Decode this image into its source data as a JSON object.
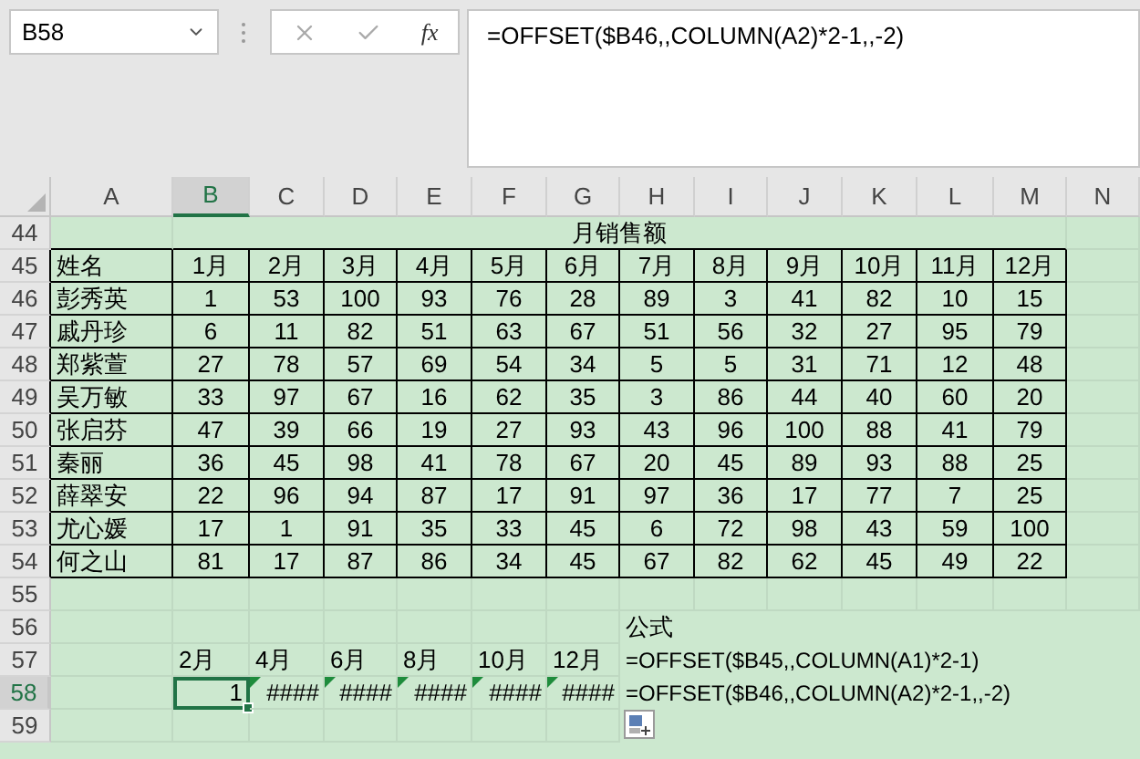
{
  "name_box": {
    "value": "B58"
  },
  "formula_bar": {
    "function_label": "fx",
    "formula": "=OFFSET($B46,,COLUMN(A2)*2-1,,-2)"
  },
  "columns": [
    {
      "label": "A",
      "selected": false
    },
    {
      "label": "B",
      "selected": true
    },
    {
      "label": "C",
      "selected": false
    },
    {
      "label": "D",
      "selected": false
    },
    {
      "label": "E",
      "selected": false
    },
    {
      "label": "F",
      "selected": false
    },
    {
      "label": "G",
      "selected": false
    },
    {
      "label": "H",
      "selected": false
    },
    {
      "label": "I",
      "selected": false
    },
    {
      "label": "J",
      "selected": false
    },
    {
      "label": "K",
      "selected": false
    },
    {
      "label": "L",
      "selected": false
    },
    {
      "label": "M",
      "selected": false
    },
    {
      "label": "N",
      "selected": false
    }
  ],
  "rows": [
    {
      "number": "44",
      "selected": false
    },
    {
      "number": "45",
      "selected": false
    },
    {
      "number": "46",
      "selected": false
    },
    {
      "number": "47",
      "selected": false
    },
    {
      "number": "48",
      "selected": false
    },
    {
      "number": "49",
      "selected": false
    },
    {
      "number": "50",
      "selected": false
    },
    {
      "number": "51",
      "selected": false
    },
    {
      "number": "52",
      "selected": false
    },
    {
      "number": "53",
      "selected": false
    },
    {
      "number": "54",
      "selected": false
    },
    {
      "number": "55",
      "selected": false
    },
    {
      "number": "56",
      "selected": false
    },
    {
      "number": "57",
      "selected": false
    },
    {
      "number": "58",
      "selected": true
    },
    {
      "number": "59",
      "selected": false
    }
  ],
  "title": "月销售额",
  "table": {
    "rows": [
      [
        "姓名",
        "1月",
        "2月",
        "3月",
        "4月",
        "5月",
        "6月",
        "7月",
        "8月",
        "9月",
        "10月",
        "11月",
        "12月"
      ],
      [
        "彭秀英",
        "1",
        "53",
        "100",
        "93",
        "76",
        "28",
        "89",
        "3",
        "41",
        "82",
        "10",
        "15"
      ],
      [
        "戚丹珍",
        "6",
        "11",
        "82",
        "51",
        "63",
        "67",
        "51",
        "56",
        "32",
        "27",
        "95",
        "79"
      ],
      [
        "郑紫萱",
        "27",
        "78",
        "57",
        "69",
        "54",
        "34",
        "5",
        "5",
        "31",
        "71",
        "12",
        "48"
      ],
      [
        "吴万敏",
        "33",
        "97",
        "67",
        "16",
        "62",
        "35",
        "3",
        "86",
        "44",
        "40",
        "60",
        "20"
      ],
      [
        "张启芬",
        "47",
        "39",
        "66",
        "19",
        "27",
        "93",
        "43",
        "96",
        "100",
        "88",
        "41",
        "79"
      ],
      [
        "秦丽",
        "36",
        "45",
        "98",
        "41",
        "78",
        "67",
        "20",
        "45",
        "89",
        "93",
        "88",
        "25"
      ],
      [
        "薛翠安",
        "22",
        "96",
        "94",
        "87",
        "17",
        "91",
        "97",
        "36",
        "17",
        "77",
        "7",
        "25"
      ],
      [
        "尤心媛",
        "17",
        "1",
        "91",
        "35",
        "33",
        "45",
        "6",
        "72",
        "98",
        "43",
        "59",
        "100"
      ],
      [
        "何之山",
        "81",
        "17",
        "87",
        "86",
        "34",
        "45",
        "67",
        "82",
        "62",
        "45",
        "49",
        "22"
      ]
    ]
  },
  "helper": {
    "label": "公式",
    "months": [
      "2月",
      "4月",
      "6月",
      "8月",
      "10月",
      "12月"
    ],
    "results": [
      {
        "text": "1",
        "selected": true,
        "error_flag": false
      },
      {
        "text": "####",
        "selected": false,
        "error_flag": true
      },
      {
        "text": "####",
        "selected": false,
        "error_flag": true
      },
      {
        "text": "####",
        "selected": false,
        "error_flag": true
      },
      {
        "text": "####",
        "selected": false,
        "error_flag": true
      },
      {
        "text": "####",
        "selected": false,
        "error_flag": true
      }
    ],
    "formulas": [
      "=OFFSET($B45,,COLUMN(A1)*2-1)",
      "=OFFSET($B46,,COLUMN(A2)*2-1,,-2)"
    ]
  }
}
